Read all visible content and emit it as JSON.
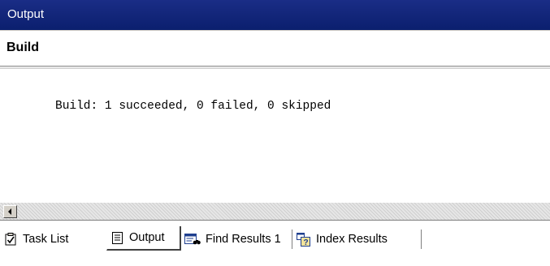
{
  "window": {
    "title": "Output"
  },
  "pane": {
    "selected": "Build"
  },
  "output": {
    "lines": [
      "Build: 1 succeeded, 0 failed, 0 skipped"
    ]
  },
  "tabs": [
    {
      "label": "Task List",
      "icon": "task-list-icon",
      "active": false
    },
    {
      "label": "Output",
      "icon": "output-icon",
      "active": true
    },
    {
      "label": "Find Results 1",
      "icon": "find-results-icon",
      "active": false
    },
    {
      "label": "Index Results",
      "icon": "index-results-icon",
      "active": false
    }
  ],
  "colors": {
    "titlebar": "#0b1f6e",
    "titlebar_text": "#ffffff"
  }
}
